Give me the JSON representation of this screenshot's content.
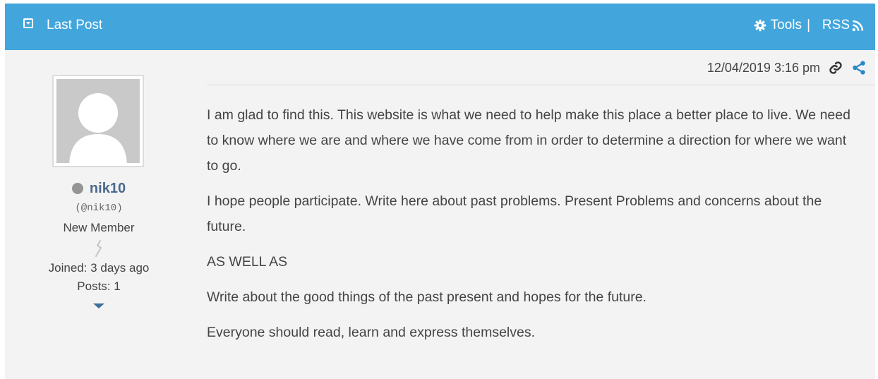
{
  "header": {
    "title": "Last Post",
    "tools_label": "Tools",
    "separator": "|",
    "rss_label": "RSS"
  },
  "post": {
    "timestamp": "12/04/2019 3:16 pm",
    "paragraphs": [
      "I am glad to find this.  This website is what we need to help make this place a better place to live.  We need to know where we are and where we have come from in order to determine a direction for where we want to go.",
      "I hope people participate.  Write here about past problems.  Present Problems and concerns about the future.",
      "AS WELL AS",
      "Write about the good things of the past present and hopes for the future.",
      "Everyone should read, learn and express themselves."
    ]
  },
  "author": {
    "name": "nik10",
    "handle": "(@nik10)",
    "rank": "New Member",
    "joined": "Joined: 3 days ago",
    "posts": "Posts: 1"
  },
  "icons": {
    "collapse": "collapse-icon",
    "tools": "gear-icon",
    "rss": "rss-icon",
    "permalink": "link-icon",
    "share": "share-icon",
    "rank": "rank-icon",
    "expand": "caret-down-icon"
  },
  "colors": {
    "header_bg": "#42a6dc",
    "panel_bg": "#f3f3f3",
    "accent": "#2b87c7",
    "username": "#4a6a8c"
  }
}
